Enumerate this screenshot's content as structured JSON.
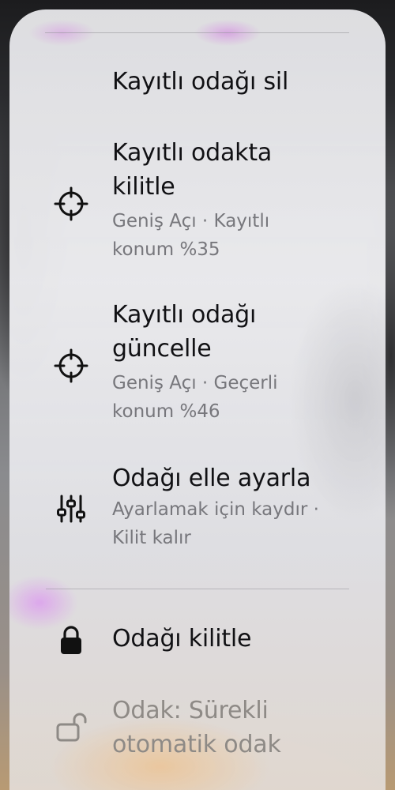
{
  "menu": {
    "items": [
      {
        "title": "Kayıtlı odağı sil",
        "subtitle": "",
        "icon": "",
        "enabled": true
      },
      {
        "title_line1": "Kayıtlı odakta",
        "title_line2": "kilitle",
        "subtitle_line1": "Geniş Açı · Kayıtlı",
        "subtitle_line2": "konum %35",
        "icon": "crosshair-icon",
        "enabled": true
      },
      {
        "title_line1": "Kayıtlı odağı",
        "title_line2": "güncelle",
        "subtitle_line1": "Geniş Açı · Geçerli",
        "subtitle_line2": "konum %46",
        "icon": "crosshair-icon",
        "enabled": true
      },
      {
        "title": "Odağı elle ayarla",
        "subtitle_line1": "Ayarlamak için kaydır ·",
        "subtitle_line2": "Kilit kalır",
        "icon": "sliders-icon",
        "enabled": true
      },
      {
        "title": "Odağı kilitle",
        "icon": "lock-icon",
        "enabled": true
      },
      {
        "title_line1": "Odak: Sürekli",
        "title_line2": "otomatik odak",
        "icon": "unlock-icon",
        "enabled": false
      }
    ]
  },
  "colors": {
    "text_primary": "#111114",
    "text_secondary": "#77777c",
    "text_disabled": "#8e8a86"
  }
}
